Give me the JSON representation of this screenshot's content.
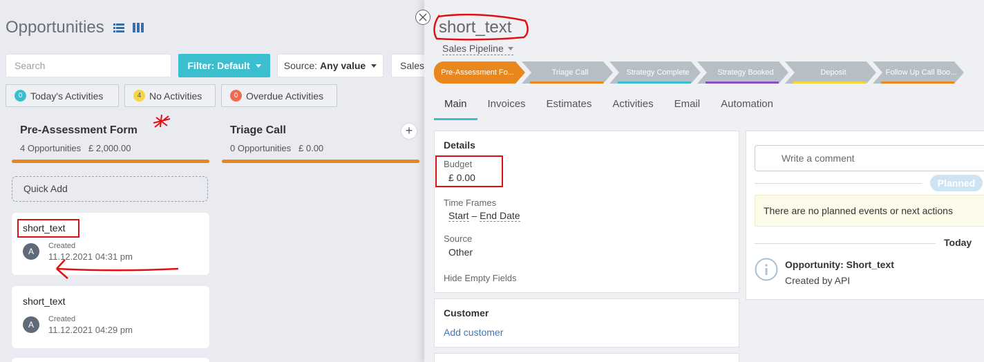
{
  "board": {
    "title": "Opportunities",
    "search_placeholder": "Search",
    "filter_label": "Filter: Default",
    "source_prefix": "Source:",
    "source_value": "Any value",
    "sales_label": "Sales",
    "activities": [
      {
        "count": "0",
        "label": "Today's Activities",
        "color": "#3bbfcf"
      },
      {
        "count": "4",
        "label": "No Activities",
        "color": "#f5d547"
      },
      {
        "count": "0",
        "label": "Overdue Activities",
        "color": "#ef6a50"
      }
    ],
    "columns": [
      {
        "title": "Pre-Assessment Form",
        "count": "4 Opportunities",
        "amount": "£ 2,000.00"
      },
      {
        "title": "Triage Call",
        "count": "0 Opportunities",
        "amount": "£ 0.00"
      }
    ],
    "quick_add": "Quick Add",
    "cards": [
      {
        "title": "short_text",
        "avatar": "A",
        "created_label": "Created",
        "date": "11.12.2021 04:31 pm"
      },
      {
        "title": "short_text",
        "avatar": "A",
        "created_label": "Created",
        "date": "11.12.2021 04:29 pm"
      }
    ]
  },
  "detail": {
    "title": "short_text",
    "pipeline": "Sales Pipeline",
    "stages": [
      {
        "label": "Pre-Assessment Fo...",
        "color": "#e8871b"
      },
      {
        "label": "Triage Call",
        "color": "#e8871b"
      },
      {
        "label": "Strategy Complete",
        "color": "#3bbfcf"
      },
      {
        "label": "Strategy Booked",
        "color": "#8a4fbf"
      },
      {
        "label": "Deposit",
        "color": "#f5d547"
      },
      {
        "label": "Follow Up Call Boo...",
        "color": "#e8871b"
      }
    ],
    "tabs": [
      "Main",
      "Invoices",
      "Estimates",
      "Activities",
      "Email",
      "Automation"
    ],
    "details_heading": "Details",
    "budget_label": "Budget",
    "budget_value": "£ 0.00",
    "timeframes_label": "Time Frames",
    "start_label": "Start",
    "dash": "–",
    "end_label": "End Date",
    "source_label": "Source",
    "source_value": "Other",
    "hide_empty": "Hide Empty Fields",
    "customer_heading": "Customer",
    "add_customer": "Add customer",
    "comment_placeholder": "Write a comment",
    "planned": "Planned",
    "no_events": "There are no planned events or next actions",
    "today": "Today",
    "opp_title": "Opportunity: Short_text",
    "opp_by": "Created by API"
  },
  "colors": {
    "accent": "#3bbfcf",
    "stage_orange": "#e8871b",
    "link": "#3a77b5"
  }
}
